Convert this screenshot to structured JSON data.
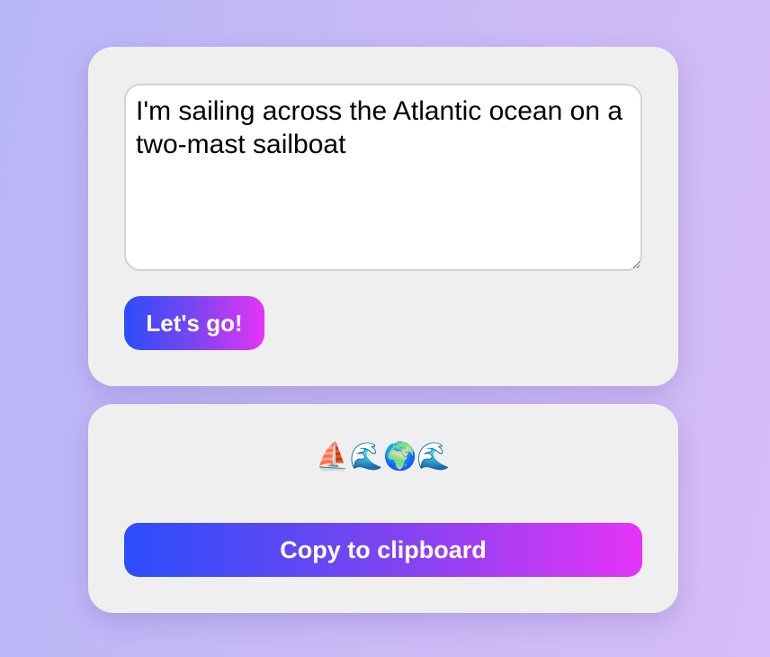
{
  "input": {
    "value": "I'm sailing across the Atlantic ocean on a two-mast sailboat"
  },
  "buttons": {
    "go_label": "Let's go!",
    "copy_label": "Copy to clipboard"
  },
  "output": {
    "emojis": "⛵🌊🌍🌊"
  }
}
